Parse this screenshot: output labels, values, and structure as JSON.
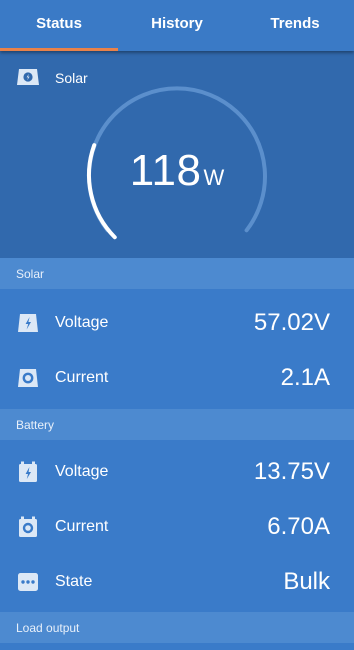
{
  "tabs": [
    {
      "label": "Status",
      "active": true
    },
    {
      "label": "History",
      "active": false
    },
    {
      "label": "Trends",
      "active": false
    }
  ],
  "hero": {
    "icon": "solar-panel-icon",
    "label": "Solar",
    "value": "118",
    "unit": "W",
    "gauge_fraction": 0.24
  },
  "sections": {
    "solar": {
      "title": "Solar",
      "voltage": {
        "icon": "lightning-icon",
        "label": "Voltage",
        "value": "57.02V"
      },
      "current": {
        "icon": "current-icon",
        "label": "Current",
        "value": "2.1A"
      }
    },
    "battery": {
      "title": "Battery",
      "voltage": {
        "icon": "battery-lightning-icon",
        "label": "Voltage",
        "value": "13.75V"
      },
      "current": {
        "icon": "battery-current-icon",
        "label": "Current",
        "value": "6.70A"
      },
      "state": {
        "icon": "more-dots-icon",
        "label": "State",
        "value": "Bulk"
      }
    },
    "load": {
      "title": "Load output"
    }
  },
  "colors": {
    "accent": "#e9824a",
    "background": "#3a7bc9",
    "hero_background": "#3169ad",
    "section_header": "#4d8ad0"
  }
}
